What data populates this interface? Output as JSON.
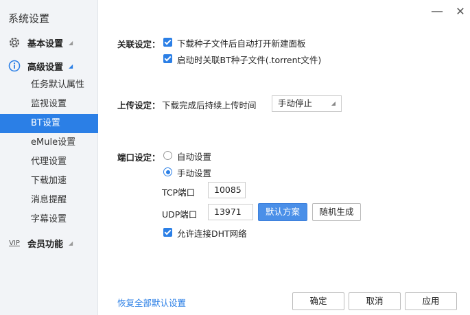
{
  "sidebar": {
    "title": "系统设置",
    "categories": [
      {
        "label": "基本设置",
        "icon": "gear-icon"
      },
      {
        "label": "高级设置",
        "icon": "info-icon"
      },
      {
        "label": "会员功能",
        "icon": "vip-icon"
      }
    ],
    "vip_icon_text": "VIP",
    "items": [
      {
        "label": "任务默认属性"
      },
      {
        "label": "监视设置"
      },
      {
        "label": "BT设置"
      },
      {
        "label": "eMule设置"
      },
      {
        "label": "代理设置"
      },
      {
        "label": "下载加速"
      },
      {
        "label": "消息提醒"
      },
      {
        "label": "字幕设置"
      }
    ],
    "active_item": "BT设置"
  },
  "window": {
    "minimize_glyph": "—",
    "close_glyph": "✕"
  },
  "association": {
    "label": "关联设定：",
    "opt1": "下载种子文件后自动打开新建面板",
    "opt2": "启动时关联BT种子文件(.torrent文件)"
  },
  "upload": {
    "label": "上传设定：",
    "desc": "下载完成后持续上传时间",
    "value": "手动停止"
  },
  "port": {
    "label": "端口设定：",
    "auto": "自动设置",
    "manual": "手动设置",
    "tcp_label": "TCP端口",
    "tcp_value": "10085",
    "udp_label": "UDP端口",
    "udp_value": "13971",
    "default_btn": "默认方案",
    "random_btn": "随机生成",
    "dht": "允许连接DHT网络"
  },
  "footer": {
    "restore": "恢复全部默认设置",
    "ok": "确定",
    "cancel": "取消",
    "apply": "应用"
  },
  "colors": {
    "accent": "#2b7fe6",
    "sidebar_bg": "#f2f4f7"
  }
}
